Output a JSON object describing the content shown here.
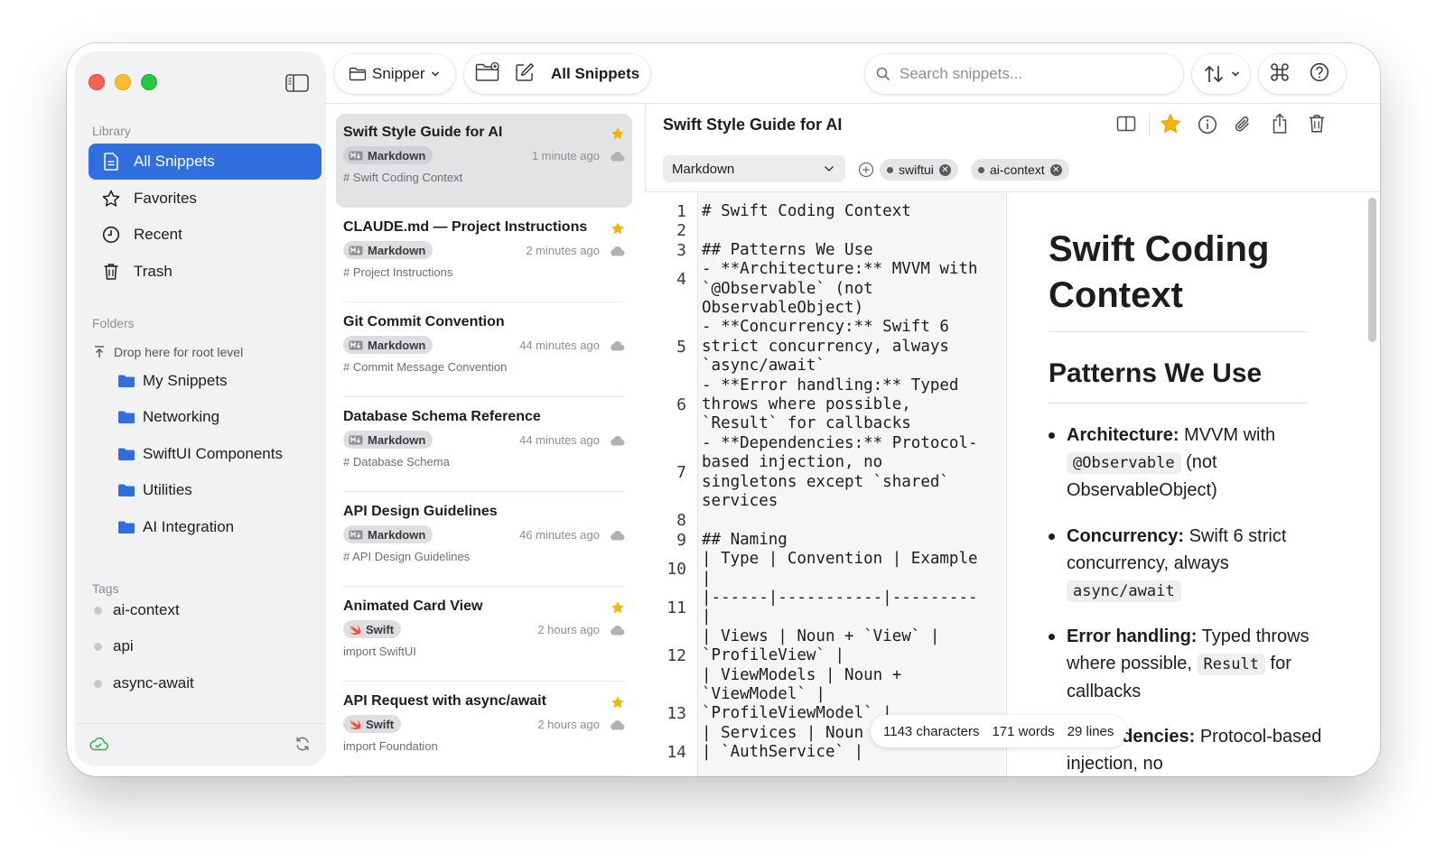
{
  "sidebar": {
    "library_header": "Library",
    "library_items": [
      {
        "label": "All Snippets",
        "icon": "document-icon",
        "active": true
      },
      {
        "label": "Favorites",
        "icon": "star-outline-icon",
        "active": false
      },
      {
        "label": "Recent",
        "icon": "clock-icon",
        "active": false
      },
      {
        "label": "Trash",
        "icon": "trash-icon",
        "active": false
      }
    ],
    "folders_header": "Folders",
    "drop_hint": "Drop here for root level",
    "folders": [
      "My Snippets",
      "Networking",
      "SwiftUI Components",
      "Utilities",
      "AI Integration"
    ],
    "tags_header": "Tags",
    "tags": [
      "ai-context",
      "api",
      "async-await"
    ]
  },
  "toolbar": {
    "library_selector": "Snipper",
    "current_view": "All Snippets",
    "search_placeholder": "Search snippets..."
  },
  "snippets": [
    {
      "title": "Swift Style Guide for AI",
      "language": "Markdown",
      "time": "1 minute ago",
      "preview": "# Swift Coding Context",
      "starred": true,
      "selected": true
    },
    {
      "title": "CLAUDE.md — Project Instructions",
      "language": "Markdown",
      "time": "2 minutes ago",
      "preview": "# Project Instructions",
      "starred": true,
      "selected": false
    },
    {
      "title": "Git Commit Convention",
      "language": "Markdown",
      "time": "44 minutes ago",
      "preview": "# Commit Message Convention",
      "starred": false,
      "selected": false
    },
    {
      "title": "Database Schema Reference",
      "language": "Markdown",
      "time": "44 minutes ago",
      "preview": "# Database Schema",
      "starred": false,
      "selected": false
    },
    {
      "title": "API Design Guidelines",
      "language": "Markdown",
      "time": "46 minutes ago",
      "preview": "# API Design Guidelines",
      "starred": false,
      "selected": false
    },
    {
      "title": "Animated Card View",
      "language": "Swift",
      "time": "2 hours ago",
      "preview": "import SwiftUI",
      "starred": true,
      "selected": false
    },
    {
      "title": "API Request with async/await",
      "language": "Swift",
      "time": "2 hours ago",
      "preview": "import Foundation",
      "starred": true,
      "selected": false
    }
  ],
  "detail": {
    "title": "Swift Style Guide for AI",
    "language": "Markdown",
    "tags": [
      "swiftui",
      "ai-context"
    ],
    "line_numbers": [
      "1",
      "2",
      "3",
      "4",
      "5",
      "6",
      "7",
      "8",
      "9",
      "10",
      "11",
      "12",
      "13",
      "14"
    ],
    "code_lines": [
      "# Swift Coding Context",
      "",
      "## Patterns We Use",
      "- **Architecture:** MVVM with",
      "`@Observable` (not",
      "ObservableObject)",
      "- **Concurrency:** Swift 6",
      "strict concurrency, always",
      "`async/await`",
      "- **Error handling:** Typed",
      "throws where possible,",
      "`Result` for callbacks",
      "- **Dependencies:** Protocol-",
      "based injection, no",
      "singletons except `shared`",
      "services",
      "",
      "## Naming",
      "| Type | Convention | Example",
      "|",
      "|------|-----------|---------",
      "|",
      "| Views | Noun + `View` |",
      "`ProfileView` |",
      "| ViewModels | Noun +",
      "`ViewModel` |",
      "`ProfileViewModel` |",
      "| Services | Noun + `Service`",
      "| `AuthService` |"
    ],
    "preview": {
      "h1": "Swift Coding Context",
      "h2": "Patterns We Use",
      "items": [
        {
          "bold": "Architecture:",
          "text1": " MVVM with ",
          "code": "@Observable",
          "text2": " (not ObservableObject)"
        },
        {
          "bold": "Concurrency:",
          "text1": " Swift 6 strict concurrency, always ",
          "code": "async/await",
          "text2": ""
        },
        {
          "bold": "Error handling:",
          "text1": " Typed throws where possible, ",
          "code": "Result",
          "text2": " for callbacks"
        },
        {
          "bold": "Dependencies:",
          "text1": " Protocol-based injection, no",
          "code": "",
          "text2": ""
        }
      ]
    },
    "stats": {
      "characters": "1143 characters",
      "words": "171 words",
      "lines": "29 lines"
    }
  },
  "colors": {
    "accent": "#2f6fde",
    "star": "#f5b400",
    "folder": "#2f6fde"
  }
}
